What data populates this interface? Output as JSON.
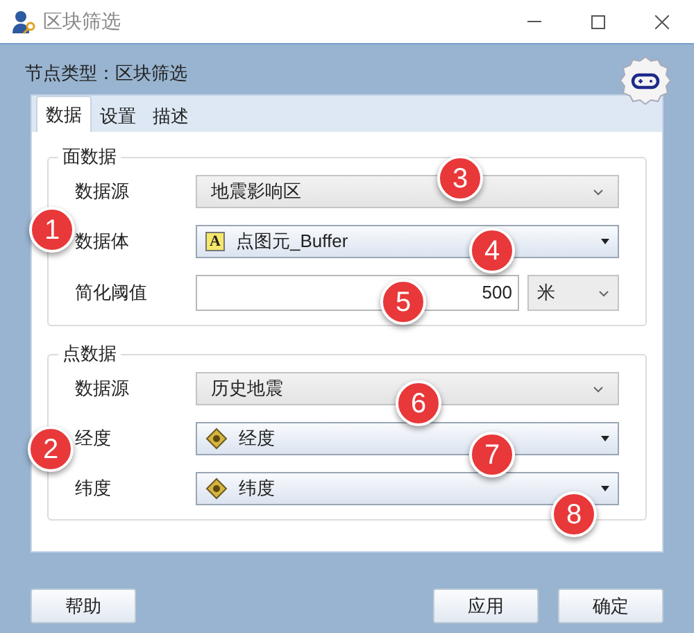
{
  "window": {
    "title": "区块筛选"
  },
  "node_type": {
    "label": "节点类型：",
    "value": "区块筛选"
  },
  "tabs": [
    {
      "label": "数据",
      "selected": true
    },
    {
      "label": "设置",
      "selected": false
    },
    {
      "label": "描述",
      "selected": false
    }
  ],
  "groups": [
    {
      "title": "面数据",
      "rows": [
        {
          "kind": "combo",
          "label": "数据源",
          "value": "地震影响区"
        },
        {
          "kind": "layer-combo",
          "glyph": "A",
          "label": "数据体",
          "value": "点图元_Buffer"
        },
        {
          "kind": "number-unit",
          "label": "简化阈值",
          "value": "500",
          "unit": "米"
        }
      ]
    },
    {
      "title": "点数据",
      "rows": [
        {
          "kind": "combo",
          "label": "数据源",
          "value": "历史地震"
        },
        {
          "kind": "field-combo",
          "label": "经度",
          "value": "经度"
        },
        {
          "kind": "field-combo",
          "label": "纬度",
          "value": "纬度"
        }
      ]
    }
  ],
  "buttons": [
    {
      "label": "帮助"
    },
    {
      "label": "应用"
    },
    {
      "label": "确定"
    }
  ],
  "callouts": [
    "1",
    "2",
    "3",
    "4",
    "5",
    "6",
    "7",
    "8"
  ]
}
